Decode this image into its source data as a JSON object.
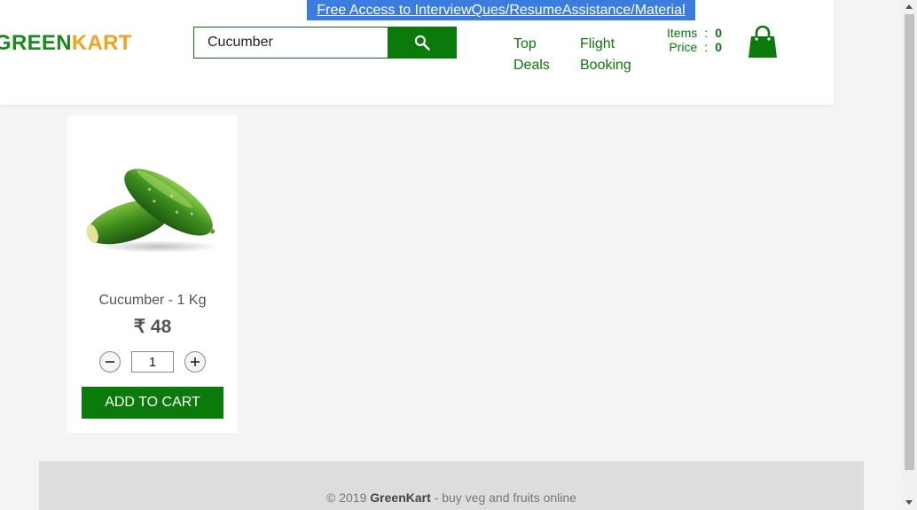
{
  "promo": {
    "text": "Free Access to InterviewQues/ResumeAssistance/Material"
  },
  "logo": {
    "green": "GREEN",
    "kart": "KART"
  },
  "search": {
    "value": "Cucumber",
    "icon": "search-icon"
  },
  "nav": [
    {
      "line1": "Top",
      "line2": "Deals"
    },
    {
      "line1": "Flight",
      "line2": "Booking"
    }
  ],
  "cart": {
    "items_label": "Items",
    "items_value": "0",
    "price_label": "Price",
    "price_value": "0",
    "separator": ":",
    "icon": "shopping-bag-icon"
  },
  "product": {
    "name": "Cucumber - 1 Kg",
    "price": "₹ 48",
    "quantity": "1",
    "decrement_symbol": "–",
    "increment_symbol": "+",
    "add_label": "ADD TO CART"
  },
  "footer": {
    "copyright": "© 2019 ",
    "brand": "GreenKart",
    "tagline": " - buy veg and fruits online"
  },
  "colors": {
    "brand_green": "#0a7a0a",
    "logo_orange": "#f7a01b",
    "promo_blue": "#3b7ddd"
  }
}
